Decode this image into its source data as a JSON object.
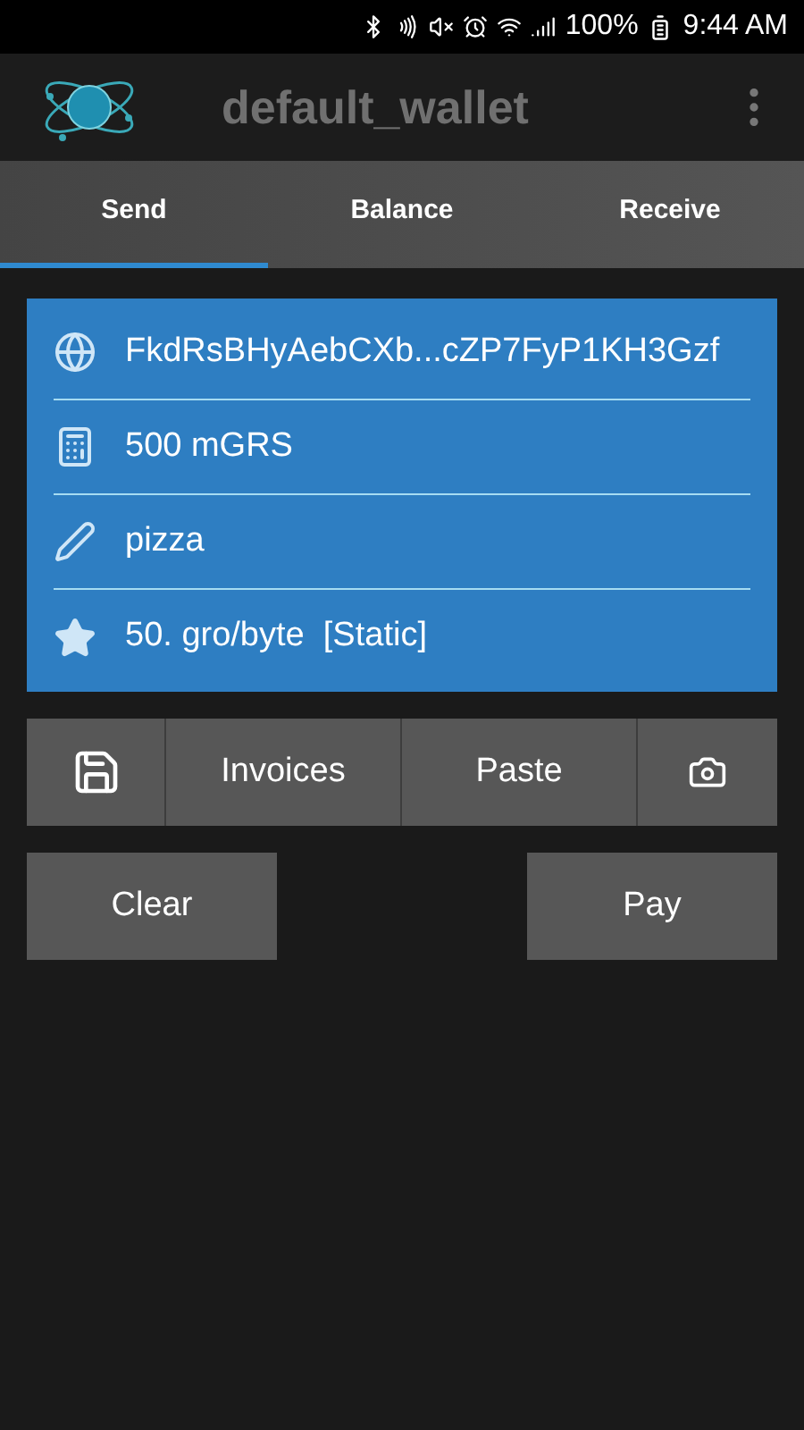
{
  "status_bar": {
    "battery": "100%",
    "time": "9:44 AM"
  },
  "app_bar": {
    "title": "default_wallet"
  },
  "tabs": [
    {
      "label": "Send",
      "selected": true
    },
    {
      "label": "Balance",
      "selected": false
    },
    {
      "label": "Receive",
      "selected": false
    }
  ],
  "fields": [
    {
      "kind": "address",
      "value": "FkdRsBHyAebCXb...cZP7FyP1KH3Gzf"
    },
    {
      "kind": "amount",
      "value": "500 mGRS"
    },
    {
      "kind": "note",
      "value": "pizza"
    },
    {
      "kind": "fee",
      "value": "50. gro/byte  [Static]"
    }
  ],
  "toolbar": [
    {
      "kind": "save"
    },
    {
      "kind": "text",
      "label": "Invoices"
    },
    {
      "kind": "text",
      "label": "Paste"
    },
    {
      "kind": "camera"
    }
  ],
  "actions": [
    "Clear",
    "Pay"
  ]
}
